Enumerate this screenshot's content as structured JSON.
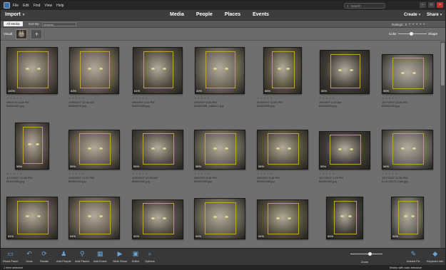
{
  "menubar": {
    "items": [
      "File",
      "Edit",
      "Find",
      "View",
      "Help"
    ],
    "search_placeholder": "Search",
    "window_controls": [
      "–",
      "□",
      "×"
    ]
  },
  "topbar": {
    "import_label": "Import",
    "nav": [
      "Media",
      "People",
      "Places",
      "Events"
    ],
    "create_label": "Create",
    "share_label": "Share"
  },
  "filterbar": {
    "all_media": "All Media",
    "sort_by": "Sort By:",
    "sort_value": "Newest",
    "ratings_label": "Ratings:",
    "ratings_value": "3",
    "stars": "★★★★★"
  },
  "visual": {
    "label": "Visual:",
    "add_label": "+",
    "color_label": "Color",
    "shape_label": "Shape",
    "color_shape_balance": 0.45
  },
  "photos": [
    {
      "pct": "100%",
      "date": "3/8/2012 6:34 PM",
      "file": "B0000081.jpg",
      "stars": "★★★★★"
    },
    {
      "pct": "63%",
      "date": "1/29/2007 12:16 AM",
      "file": "B0000079.jpg",
      "stars": "★★★★★"
    },
    {
      "pct": "61%",
      "date": "3/8/2007 6:42 PM",
      "file": "B0000408.jpg",
      "stars": "★★★★★"
    },
    {
      "pct": "30%",
      "date": "3/8/2007 6:35 PM",
      "file": "B0000408_edited-1.jpg",
      "stars": "★★★★★"
    },
    {
      "pct": "58%",
      "date": "2/26/2007 11:00 PM",
      "file": "B0000059.jpg",
      "stars": "★★★★★"
    },
    {
      "pct": "56%",
      "date": "3/8/2007 1:19 AM",
      "file": "B0000420.jpg",
      "stars": "★★★★★"
    },
    {
      "pct": "55%",
      "date": "4/17/2007 11:28 PM",
      "file": "B0000190.jpg",
      "stars": "★★★★★"
    },
    {
      "pct": "58%",
      "date": "4/17/2007 11:28 PM",
      "file": "B0000084.jpg",
      "stars": "★★★★★"
    },
    {
      "pct": "55%",
      "date": "1/29/2007 11:20 PM",
      "file": "B0000324.jpg",
      "stars": "★★★★★"
    },
    {
      "pct": "55%",
      "date": "1/29/2007 12:30 AM",
      "file": "B0000300.jpg",
      "stars": "★★★★★"
    },
    {
      "pct": "58%",
      "date": "3/8/2007 6:48 PM",
      "file": "B0000399.jpg",
      "stars": "★★★★★"
    },
    {
      "pct": "58%",
      "date": "3/8/2007 6:48 PM",
      "file": "B0000408.jpg",
      "stars": "★★★★★"
    },
    {
      "pct": "55%",
      "date": "4/17/2007 1:28 PM",
      "file": "B0000422.jpg",
      "stars": "★★★★★"
    },
    {
      "pct": "54%",
      "date": "4/17/2007 11:28 PM",
      "file": "6-19-20070-Cats.jpg",
      "stars": "★★★★★"
    },
    {
      "pct": "54%",
      "date": "",
      "file": "",
      "stars": ""
    },
    {
      "pct": "54%",
      "date": "",
      "file": "",
      "stars": ""
    },
    {
      "pct": "54%",
      "date": "",
      "file": "",
      "stars": ""
    },
    {
      "pct": "54%",
      "date": "",
      "file": "",
      "stars": ""
    },
    {
      "pct": "54%",
      "date": "",
      "file": "",
      "stars": ""
    },
    {
      "pct": "54%",
      "date": "",
      "file": "",
      "stars": ""
    },
    {
      "pct": "54%",
      "date": "",
      "file": "",
      "stars": ""
    }
  ],
  "bottombar": {
    "tools": [
      "Show Panel",
      "Undo",
      "Rotate",
      "Add People",
      "Add Places",
      "Add Event",
      "Slide Show",
      "Editor",
      "Options"
    ],
    "zoom_label": "Zoom",
    "zoom_level": 0.6,
    "instant_fix": "Instant Fix",
    "keyword": "Keyword Info"
  },
  "statusbar": {
    "left": "1 item selected",
    "right": "Works with auto-enhance"
  },
  "colors": {
    "accent_blue": "#6ba4d8",
    "face_box": "#c2a52c",
    "background": "#6e6e6e"
  }
}
